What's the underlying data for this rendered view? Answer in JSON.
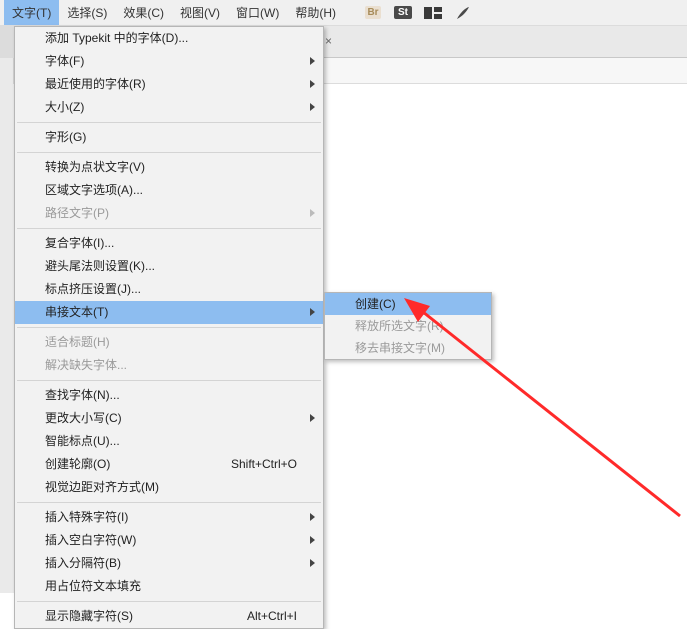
{
  "menubar": {
    "items": [
      {
        "label": "文字(T)"
      },
      {
        "label": "选择(S)"
      },
      {
        "label": "效果(C)"
      },
      {
        "label": "视图(V)"
      },
      {
        "label": "窗口(W)"
      },
      {
        "label": "帮助(H)"
      }
    ],
    "icons": {
      "br": "Br",
      "st": "St"
    }
  },
  "tabbar": {
    "close": "×"
  },
  "type_menu": {
    "add_typekit": "添加 Typekit 中的字体(D)...",
    "font": "字体(F)",
    "recent": "最近使用的字体(R)",
    "size": "大小(Z)",
    "glyphs": "字形(G)",
    "convert_point": "转换为点状文字(V)",
    "area_opts": "区域文字选项(A)...",
    "path_type": "路径文字(P)",
    "composite": "复合字体(I)...",
    "kinsoku": "避头尾法则设置(K)...",
    "mojikumi": "标点挤压设置(J)...",
    "threaded": "串接文本(T)",
    "fit_headline": "适合标题(H)",
    "resolve_missing": "解决缺失字体...",
    "find_font": "查找字体(N)...",
    "change_case": "更改大小写(C)",
    "smart_punct": "智能标点(U)...",
    "create_outlines": "创建轮廓(O)",
    "create_outlines_sc": "Shift+Ctrl+O",
    "margin_align": "视觉边距对齐方式(M)",
    "insert_special": "插入特殊字符(I)",
    "insert_blank": "插入空白字符(W)",
    "insert_break": "插入分隔符(B)",
    "placeholder_fill": "用占位符文本填充",
    "show_hidden": "显示隐藏字符(S)",
    "show_hidden_sc": "Alt+Ctrl+I"
  },
  "threaded_submenu": {
    "create": "创建(C)",
    "release": "释放所选文字(R)",
    "remove": "移去串接文字(M)"
  }
}
